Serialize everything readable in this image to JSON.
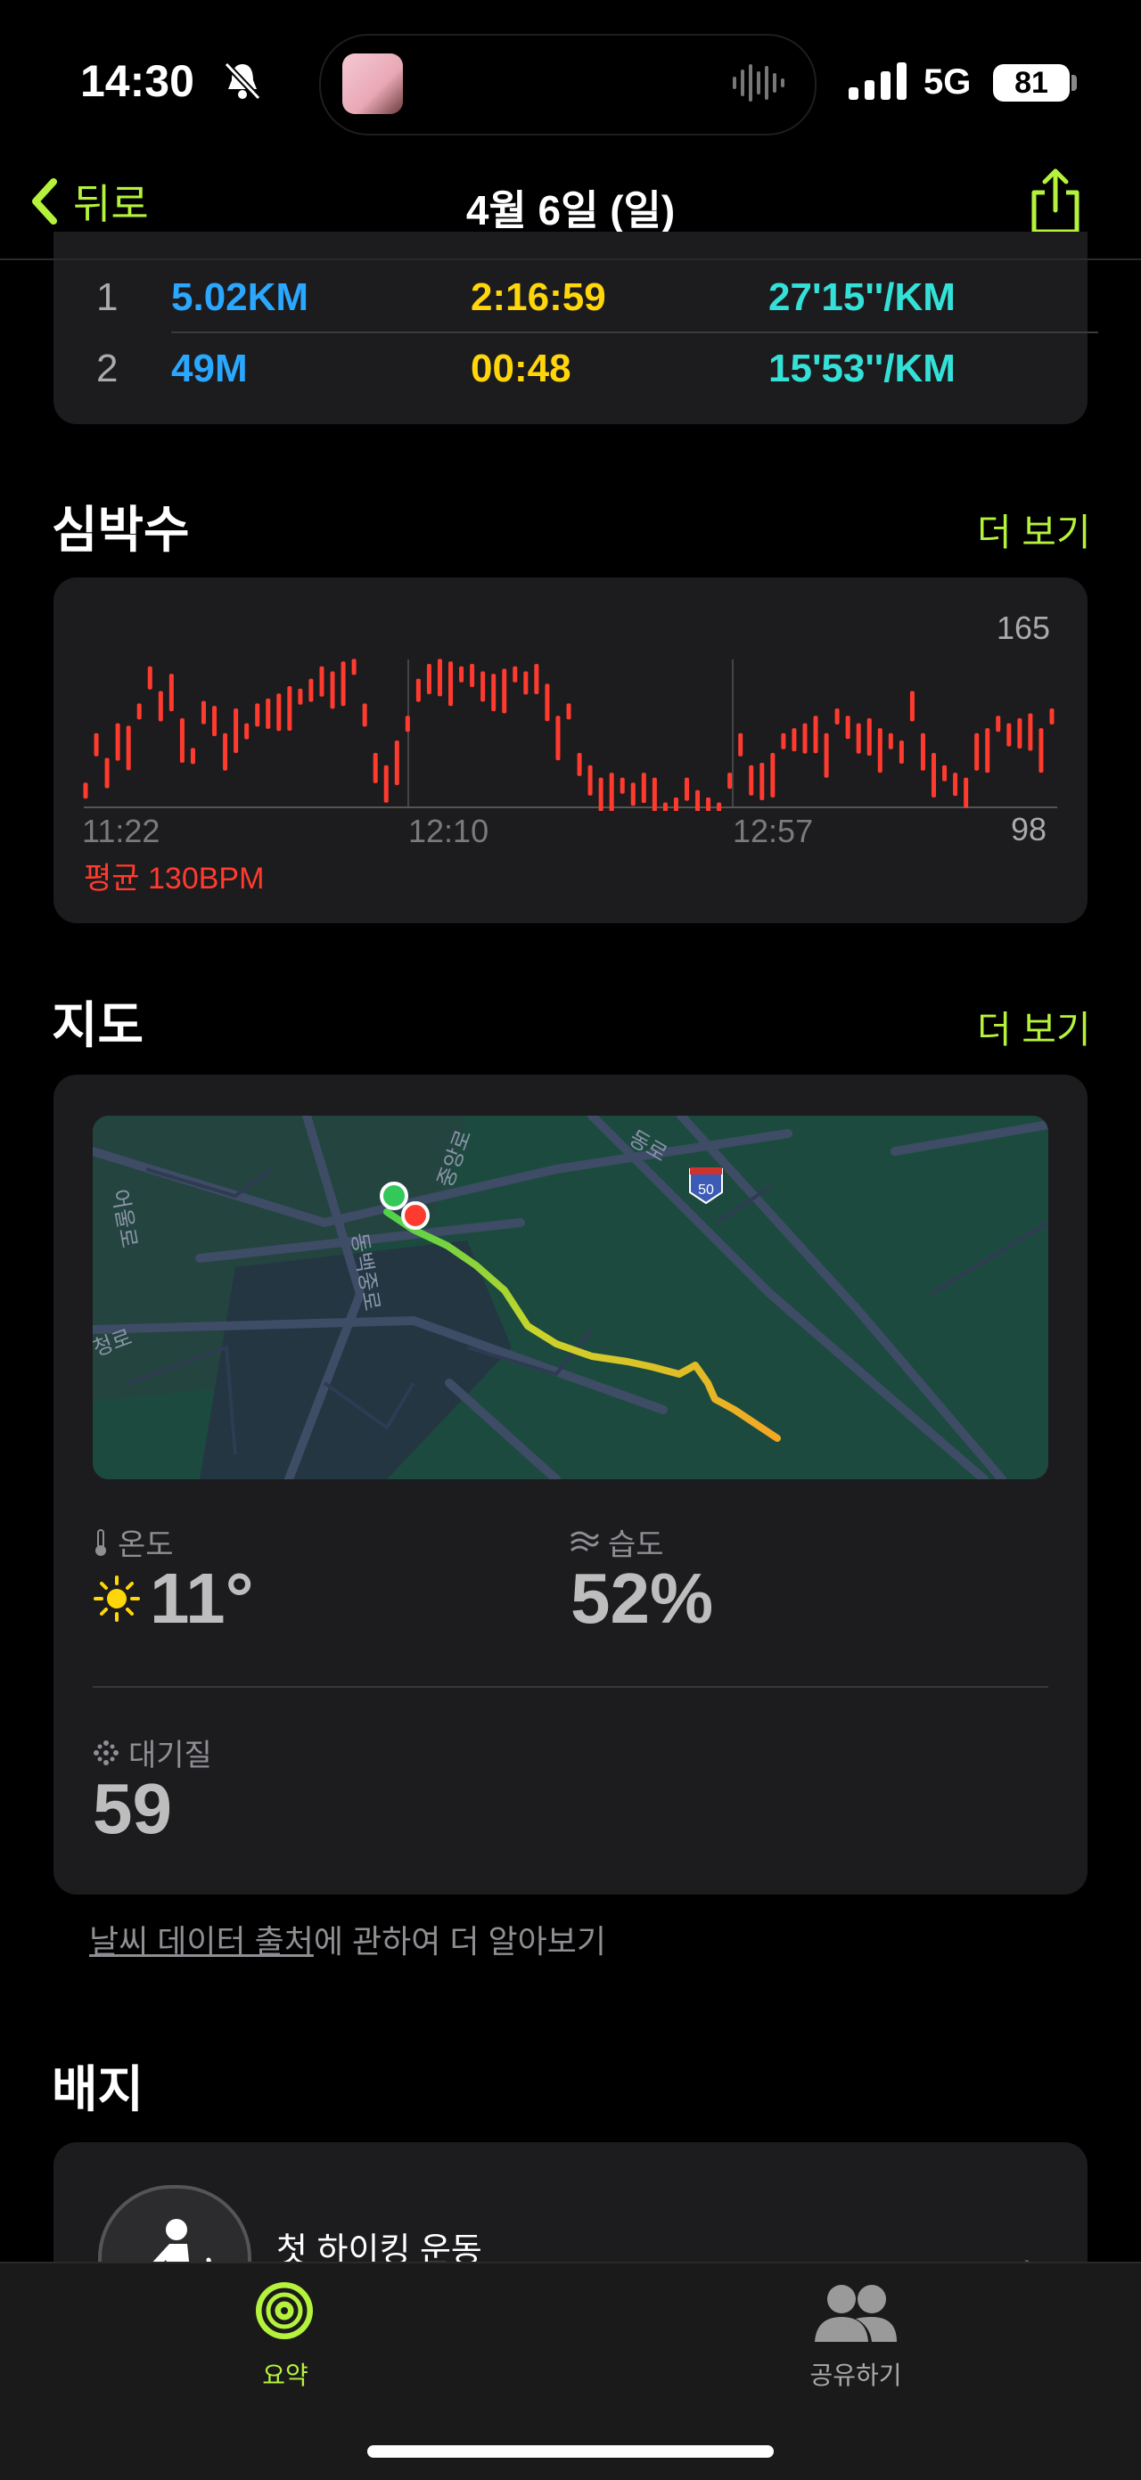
{
  "status_bar": {
    "time": "14:30",
    "network": "5G",
    "battery": "81"
  },
  "nav": {
    "back_label": "뒤로",
    "title": "4월 6일 (일)"
  },
  "splits": [
    {
      "index": "1",
      "distance": "5.02KM",
      "time": "2:16:59",
      "pace": "27'15''/KM"
    },
    {
      "index": "2",
      "distance": "49M",
      "time": "00:48",
      "pace": "15'53''/KM"
    }
  ],
  "heart": {
    "title": "심박수",
    "more": "더 보기",
    "max_label": "165",
    "min_label": "98",
    "ticks": [
      "11:22",
      "12:10",
      "12:57"
    ],
    "average": "평균 130BPM",
    "accent": "#ff3b2f"
  },
  "chart_data": {
    "type": "bar",
    "ylim": [
      98,
      165
    ],
    "x": [
      "11:22",
      "12:10",
      "12:57"
    ],
    "series": [
      {
        "values": [
          108,
          128,
          118,
          132,
          131,
          140,
          155,
          145,
          152,
          134,
          122,
          141,
          139,
          128,
          138,
          132,
          140,
          142,
          144,
          147,
          146,
          150,
          155,
          153,
          157,
          158,
          140,
          120,
          115,
          125,
          135,
          150,
          156,
          158,
          157,
          155,
          156,
          153,
          152,
          154,
          155,
          153,
          156,
          148,
          135,
          140,
          120,
          115,
          110,
          112,
          110,
          108,
          112,
          110,
          100,
          102,
          110,
          105,
          102,
          100,
          112,
          128,
          115,
          116,
          120,
          128,
          130,
          132,
          135,
          128,
          138,
          135,
          132,
          134,
          130,
          128,
          125,
          145,
          128,
          120,
          115,
          112,
          110,
          128,
          130,
          135,
          132,
          134,
          136,
          130,
          138
        ]
      }
    ]
  },
  "map": {
    "title": "지도",
    "more": "더 보기",
    "highway": "50",
    "roads": [
      "동백중로",
      "중앙로",
      "어울로",
      "청로",
      "동로"
    ]
  },
  "weather": {
    "temp_label": "온도",
    "temp_value": "11°",
    "humidity_label": "습도",
    "humidity_value": "52%",
    "air_label": "대기질",
    "air_value": "59",
    "source_link": "날씨 데이터 출처",
    "source_rest": "에 관하여 더 알아보기"
  },
  "badges": {
    "title": "배지",
    "first_badge": "첫 하이킹 운동"
  },
  "tabs": {
    "summary": "요약",
    "share": "공유하기"
  },
  "colors": {
    "accent": "#b5f23b",
    "distance": "#2aa7ff",
    "time": "#ffd60a",
    "pace": "#33e1d8"
  }
}
